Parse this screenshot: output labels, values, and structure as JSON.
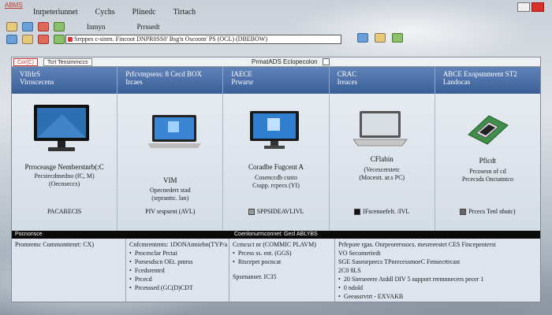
{
  "app_title": "ABMS",
  "menu": [
    "Inrpeteriunnet",
    "Cychs",
    "Plinedc",
    "Tirtach"
  ],
  "toolbar": {
    "row1_labels": [
      "Inmyn",
      "Prrssedt"
    ],
    "address": "Srrppes c-sinrn. Fincoot DNPR0SS0' Bsg'n Oscootn' PS (OCL) (DBEBOW)"
  },
  "tabs": {
    "left": "Cor(C)",
    "left2": "Tcrt Tensimmccs",
    "center": "PrmatADS Eclopecolon"
  },
  "columns": [
    {
      "header": "VIfrlrS\nViroscecens",
      "name": "Prroceasge Nemberstnrb(:C",
      "desc": "Pecstecdmedno (fC, M)\n(Oecnseccs)",
      "foot": "PACARECIS",
      "icon": "desktop-monitor-icon"
    },
    {
      "header": "Prfcvmpsess: 8 Cecd BOX\nIrcaes",
      "name": "VIM",
      "desc": "Opecnedert stad\n(srpranttc. lan)",
      "foot": "PIV srspsent (AVL)",
      "icon": "laptop-icon"
    },
    {
      "header": "IAECE\nPrwarsr",
      "name": "Coradbe Fugcent A",
      "desc": "Cosenccdb csnto\nCsspp. rcpecs (YI)",
      "foot": "SPPSIDEAVLIVL",
      "icon": "monitor-icon"
    },
    {
      "header": "CRAC\nIreaces",
      "name": "CFlabin",
      "desc": "(Vecescerstetc\n(Mocestt. ar.s PC)",
      "foot": "IFscenoefelt. /IVL",
      "icon": "notebook-icon"
    },
    {
      "header": "ABCE Exopsmmrent ST2\nLandocas",
      "name": "Pficdt",
      "desc": "Prcosesn of cd\nPrcecsds Onctatntco",
      "foot": "Prcecs Tenl nbutc)",
      "icon": "chip-icon"
    }
  ],
  "lower": {
    "bar_left": "Pocnonsce",
    "bar_center": "Coenlonurmconnet: Gecl ABLYBS",
    "col1": [
      "Promremc Commonttenrt: CX)"
    ],
    "col2": [
      "Cnfcmrentents: 1DONAtmiebn(TYP/a",
      "Procesclar Prctai",
      "Porsesdscn OEt. pmrss",
      "Fcedsrentrd",
      "Prcecd",
      "Prcesssed (GC(D)CDT"
    ],
    "col3": [
      "Prcess ss. ent. (GGS)",
      "Rtscepet pocncat",
      "Spsenanser. IC35"
    ],
    "col3_head": "Ccmcsct nr (COMMIC PLAVM)",
    "col4": [
      "Prfepore rgas. Onrpeorerssocs. mesreeestet CES Fincepeoterst",
      "VO Secomeriedt",
      "SGE Saseorpeecs TPnrecessmoeC Fensecrtrcast",
      "2C0 8LS",
      "20 Sierseeere Atddl DIV 5 support rremnnecers pecer 1",
      "0 ndold",
      "Geeassrvtrt - EXVAKB"
    ]
  },
  "colors": {
    "header_blue": "#3a5f98",
    "accent_red": "#c33",
    "dark_bar": "#0b0b0b"
  }
}
